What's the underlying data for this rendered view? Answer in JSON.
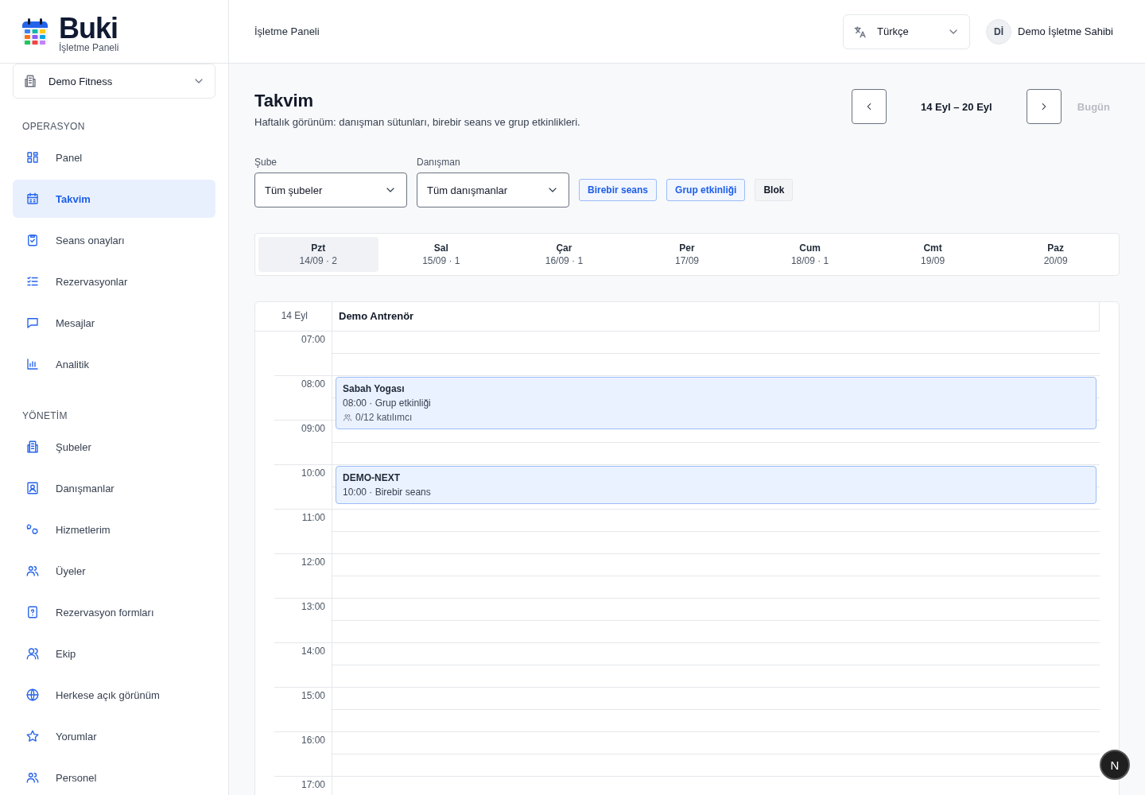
{
  "brand": {
    "name": "Buki",
    "subtitle": "İşletme Paneli"
  },
  "business_select": {
    "value": "Demo Fitness"
  },
  "sidebar": {
    "sections": [
      {
        "title": "OPERASYON",
        "items": [
          {
            "label": "Panel",
            "selected": false
          },
          {
            "label": "Takvim",
            "selected": true
          },
          {
            "label": "Seans onayları",
            "selected": false
          },
          {
            "label": "Rezervasyonlar",
            "selected": false
          },
          {
            "label": "Mesajlar",
            "selected": false
          },
          {
            "label": "Analitik",
            "selected": false
          }
        ]
      },
      {
        "title": "YÖNETİM",
        "items": [
          {
            "label": "Şubeler",
            "selected": false
          },
          {
            "label": "Danışmanlar",
            "selected": false
          },
          {
            "label": "Hizmetlerim",
            "selected": false
          },
          {
            "label": "Üyeler",
            "selected": false
          },
          {
            "label": "Rezervasyon formları",
            "selected": false
          },
          {
            "label": "Ekip",
            "selected": false
          },
          {
            "label": "Herkese açık görünüm",
            "selected": false
          },
          {
            "label": "Yorumlar",
            "selected": false
          },
          {
            "label": "Personel",
            "selected": false
          }
        ]
      }
    ]
  },
  "header": {
    "breadcrumb": "İşletme Paneli",
    "language": "Türkçe",
    "user": {
      "initials": "Dİ",
      "name": "Demo İşletme Sahibi"
    }
  },
  "page": {
    "title": "Takvim",
    "subtitle": "Haftalık görünüm: danışman sütunları, birebir seans ve grup etkinlikleri.",
    "range": "14 Eyl – 20 Eyl",
    "today": {
      "label": "Bugün",
      "disabled": true
    }
  },
  "filters": [
    {
      "label": "Şube",
      "value": "Tüm şubeler"
    },
    {
      "label": "Danışman",
      "value": "Tüm danışmanlar"
    }
  ],
  "actions": [
    {
      "label": "Birebir seans",
      "kind": "primary"
    },
    {
      "label": "Grup etkinliği",
      "kind": "primary"
    },
    {
      "label": "Blok",
      "kind": "neutral"
    }
  ],
  "days": [
    {
      "name": "Pzt",
      "date": "14/09 · 2",
      "selected": true
    },
    {
      "name": "Sal",
      "date": "15/09 · 1",
      "selected": false
    },
    {
      "name": "Çar",
      "date": "16/09 · 1",
      "selected": false
    },
    {
      "name": "Per",
      "date": "17/09",
      "selected": false
    },
    {
      "name": "Cum",
      "date": "18/09 · 1",
      "selected": false
    },
    {
      "name": "Cmt",
      "date": "19/09",
      "selected": false
    },
    {
      "name": "Paz",
      "date": "20/09",
      "selected": false
    }
  ],
  "calendar": {
    "date": "14 Eyl",
    "column": "Demo Antrenör",
    "hours": [
      {
        "time": "07:00"
      },
      {
        "time": "08:00",
        "events": [
          {
            "title": "Sabah Yogası",
            "meta": "08:00 · Grup etkinliği",
            "attendees": "0/12 katılımcı"
          }
        ]
      },
      {
        "time": "09:00"
      },
      {
        "time": "10:00",
        "events": [
          {
            "title": "DEMO-NEXT",
            "meta": "10:00 · Birebir seans"
          }
        ]
      },
      {
        "time": "11:00"
      },
      {
        "time": "12:00"
      },
      {
        "time": "13:00"
      },
      {
        "time": "14:00"
      },
      {
        "time": "15:00"
      },
      {
        "time": "16:00"
      },
      {
        "time": "17:00"
      }
    ]
  },
  "fab": {
    "label": "N"
  }
}
